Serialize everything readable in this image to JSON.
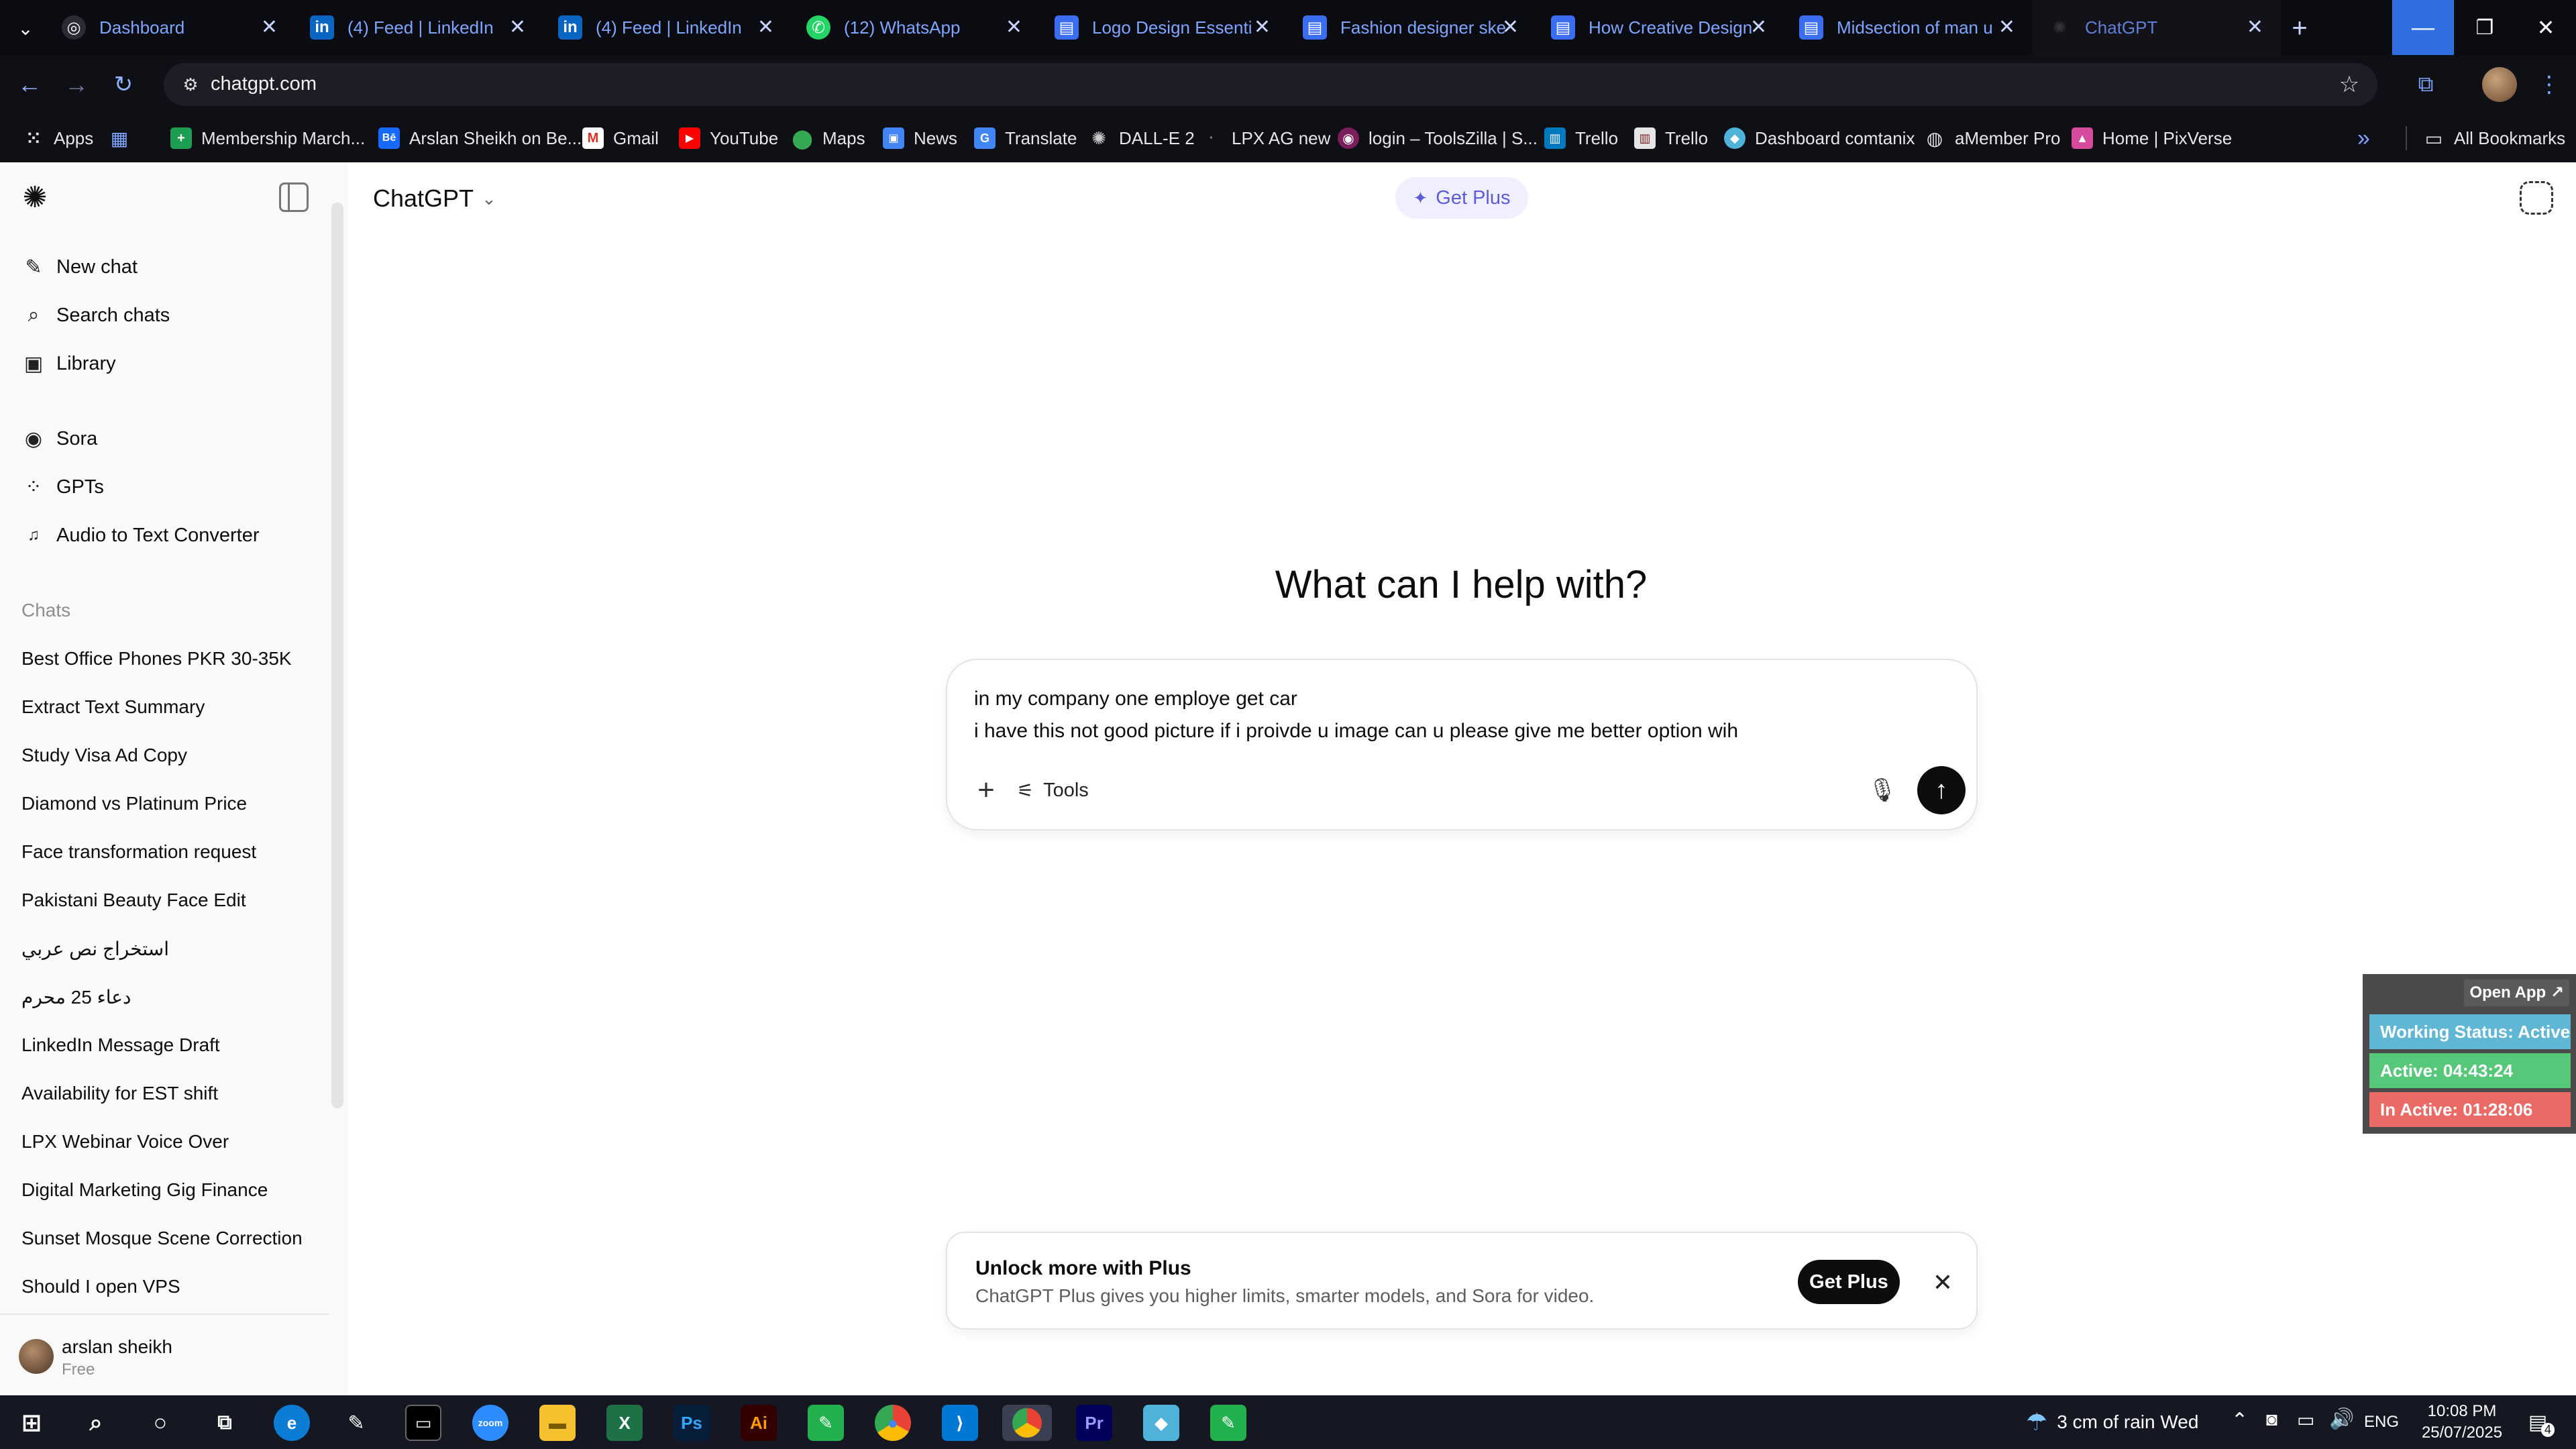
{
  "browser": {
    "tabs": [
      {
        "title": "Dashboard",
        "favicon": "dashboard-icon",
        "active": false
      },
      {
        "title": "(4) Feed | LinkedIn",
        "favicon": "linkedin-icon",
        "active": false
      },
      {
        "title": "(4) Feed | LinkedIn",
        "favicon": "linkedin-icon",
        "active": false
      },
      {
        "title": "(12) WhatsApp",
        "favicon": "whatsapp-icon",
        "active": false
      },
      {
        "title": "Logo Design Essenti",
        "favicon": "docs-icon",
        "active": false
      },
      {
        "title": "Fashion designer ske",
        "favicon": "docs-icon",
        "active": false
      },
      {
        "title": "How Creative Design",
        "favicon": "docs-icon",
        "active": false
      },
      {
        "title": "Midsection of man u",
        "favicon": "docs-icon",
        "active": false
      },
      {
        "title": "ChatGPT",
        "favicon": "chatgpt-icon",
        "active": true
      }
    ],
    "url": "chatgpt.com",
    "bookmarks": [
      {
        "label": "Apps"
      },
      {
        "label": "Membership March..."
      },
      {
        "label": "Arslan Sheikh on Be..."
      },
      {
        "label": "Gmail"
      },
      {
        "label": "YouTube"
      },
      {
        "label": "Maps"
      },
      {
        "label": "News"
      },
      {
        "label": "Translate"
      },
      {
        "label": "DALL-E 2"
      },
      {
        "label": "LPX AG new"
      },
      {
        "label": "login – ToolsZilla | S..."
      },
      {
        "label": "Trello"
      },
      {
        "label": "Trello"
      },
      {
        "label": "Dashboard comtanix"
      },
      {
        "label": "aMember Pro"
      },
      {
        "label": "Home | PixVerse"
      }
    ],
    "all_bookmarks": "All Bookmarks",
    "more_chevron": "»"
  },
  "sidebar": {
    "nav": [
      {
        "label": "New chat",
        "icon": "compose-icon"
      },
      {
        "label": "Search chats",
        "icon": "search-icon"
      },
      {
        "label": "Library",
        "icon": "library-icon"
      },
      {
        "label": "Sora",
        "icon": "sora-icon"
      },
      {
        "label": "GPTs",
        "icon": "gpts-grid-icon"
      },
      {
        "label": "Audio to Text Converter",
        "icon": "audio-gpt-icon"
      }
    ],
    "chats_heading": "Chats",
    "chats": [
      "Best Office Phones PKR 30-35K",
      "Extract Text Summary",
      "Study Visa Ad Copy",
      "Diamond vs Platinum Price",
      "Face transformation request",
      "Pakistani Beauty Face Edit",
      "استخراج نص عربي",
      "دعاء 25 محرم",
      "LinkedIn Message Draft",
      "Availability for EST shift",
      "LPX Webinar Voice Over",
      "Digital Marketing Gig Finance",
      "Sunset Mosque Scene Correction",
      "Should I open VPS"
    ],
    "user": {
      "name": "arslan sheikh",
      "plan": "Free"
    }
  },
  "main": {
    "model_selector": "ChatGPT",
    "get_plus_top": "Get Plus",
    "heading": "What can I help with?",
    "composer": {
      "line1": "in my company one employe get car",
      "line2": "i have this not good picture if i proivde u image can u please give me better option wih",
      "tools_label": "Tools"
    },
    "promo": {
      "title": "Unlock more with Plus",
      "body": "ChatGPT Plus gives you higher limits, smarter models, and Sora for video.",
      "button": "Get Plus"
    }
  },
  "tracker": {
    "open_app": "Open App ↗",
    "working_status": "Working Status: Active",
    "active": "Active: 04:43:24",
    "inactive": "In Active: 01:28:06",
    "colors": {
      "status": "#5fb7d4",
      "active": "#57c87a",
      "inactive": "#ea6b66"
    }
  },
  "taskbar": {
    "weather": "3 cm of rain Wed",
    "language": "ENG",
    "time": "10:08 PM",
    "date": "25/07/2025",
    "notifications": "4"
  },
  "colors": {
    "tab_bg": "#0b0b12",
    "chrome_bg": "#0f0f16",
    "sidebar_bg": "#f9f9f9",
    "accent_plus": "#5d5bd6",
    "tab_title": "#7fa6ff"
  }
}
